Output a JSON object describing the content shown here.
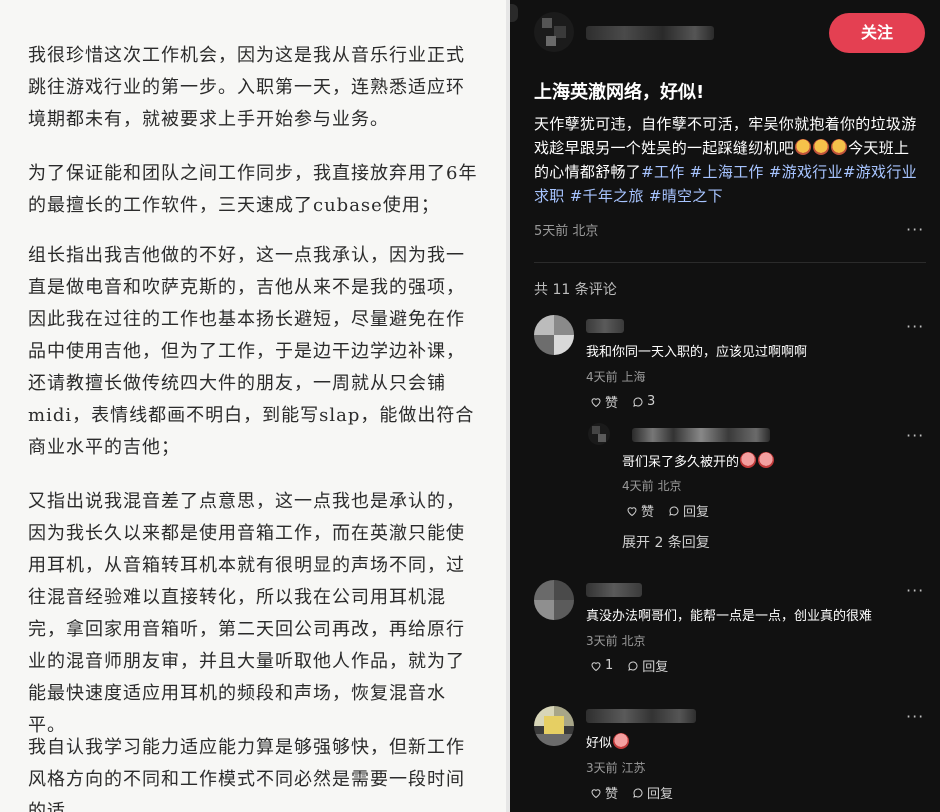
{
  "article": {
    "paragraphs": [
      "我很珍惜这次工作机会，因为这是我从音乐行业正式跳往游戏行业的第一步。入职第一天，连熟悉适应环境期都未有，就被要求上手开始参与业务。",
      "为了保证能和团队之间工作同步，我直接放弃用了6年的最擅长的工作软件，三天速成了cubase使用；",
      "组长指出我吉他做的不好，这一点我承认，因为我一直是做电音和吹萨克斯的，吉他从来不是我的强项，因此我在过往的工作也基本扬长避短，尽量避免在作品中使用吉他，但为了工作，于是边干边学边补课，还请教擅长做传统四大件的朋友，一周就从只会铺midi，表情线都画不明白，到能写slap，能做出符合商业水平的吉他；",
      "又指出说我混音差了点意思，这一点我也是承认的，因为我长久以来都是使用音箱工作，而在英澈只能使用耳机，从音箱转耳机本就有很明显的声场不同，过往混音经验难以直接转化，所以我在公司用耳机混完，拿回家用音箱听，第二天回公司再改，再给原行业的混音师朋友审，并且大量听取他人作品，就为了能最快速度适应用耳机的频段和声场，恢复混音水平。",
      "我自认我学习能力适应能力算是够强够快，但新工作风格方向的不同和工作模式不同必然是需要一段时间的适"
    ]
  },
  "post": {
    "follow_label": "关注",
    "title": "上海英澈网络，好似!",
    "body_text": "天作孽犹可违，自作孽不可活，牢吴你就抱着你的垃圾游戏趁早跟另一个姓吴的一起踩缝纫机吧",
    "body_text2": "今天班上的心情都舒畅了",
    "tags": [
      "#工作",
      "#上海工作",
      "#游戏行业",
      "#游戏行业求职",
      "#千年之旅",
      "#晴空之下"
    ],
    "meta": "5天前 北京",
    "more": "···"
  },
  "comments_count": "共 11 条评论",
  "comments": [
    {
      "text": "我和你同一天入职的，应该见过啊啊啊",
      "meta": "4天前 上海",
      "like": "赞",
      "reply_count": "3"
    },
    {
      "text": "哥们呆了多久被开的",
      "meta": "4天前 北京",
      "like": "赞",
      "reply": "回复"
    },
    {
      "text": "真没办法啊哥们，能帮一点是一点，创业真的很难",
      "meta": "3天前 北京",
      "like": "1",
      "reply": "回复"
    },
    {
      "text": "好似",
      "meta": "3天前 江苏",
      "like": "赞",
      "reply": "回复"
    }
  ],
  "expand_label": "展开 2 条回复",
  "more": "···"
}
